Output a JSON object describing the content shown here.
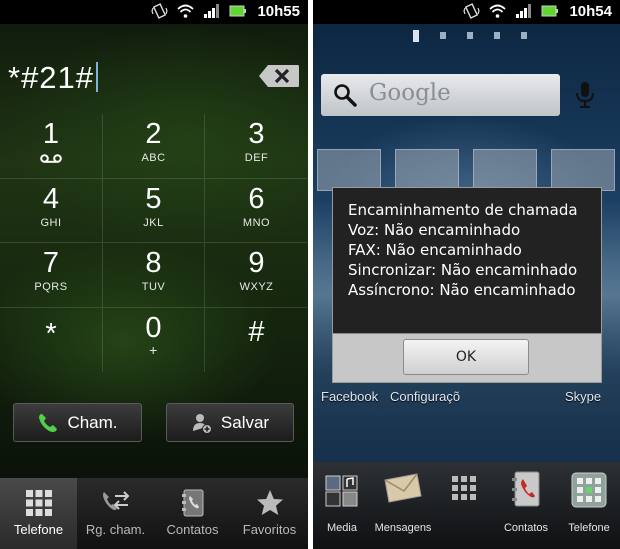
{
  "left_screen": {
    "status": {
      "time": "10h55",
      "icons": [
        "vibrate-icon",
        "wifi-icon",
        "signal-icon",
        "battery-icon"
      ]
    },
    "dial_number": "*#21#",
    "keypad": [
      {
        "digit": "1",
        "letters": ""
      },
      {
        "digit": "2",
        "letters": "ABC"
      },
      {
        "digit": "3",
        "letters": "DEF"
      },
      {
        "digit": "4",
        "letters": "GHI"
      },
      {
        "digit": "5",
        "letters": "JKL"
      },
      {
        "digit": "6",
        "letters": "MNO"
      },
      {
        "digit": "7",
        "letters": "PQRS"
      },
      {
        "digit": "8",
        "letters": "TUV"
      },
      {
        "digit": "9",
        "letters": "WXYZ"
      },
      {
        "digit": "*",
        "letters": ""
      },
      {
        "digit": "0",
        "letters": "+"
      },
      {
        "digit": "#",
        "letters": ""
      }
    ],
    "call_button": "Cham.",
    "save_button": "Salvar",
    "tabs": [
      "Telefone",
      "Rg. cham.",
      "Contatos",
      "Favoritos"
    ],
    "active_tab": "Telefone"
  },
  "right_screen": {
    "status": {
      "time": "10h54",
      "icons": [
        "vibrate-icon",
        "wifi-icon",
        "signal-icon",
        "battery-icon"
      ]
    },
    "search_label": "Google",
    "app_labels": [
      "Facebook",
      "Configuraçõ",
      "Skype"
    ],
    "dialog": {
      "lines": [
        "Encaminhamento de chamada",
        "Voz: Não encaminhado",
        "FAX: Não encaminhado",
        "Sincronizar: Não encaminhado",
        "Assíncrono: Não encaminhado"
      ],
      "ok_label": "OK"
    },
    "dock": [
      "Media",
      "Mensagens",
      "",
      "Contatos",
      "Telefone"
    ]
  },
  "colors": {
    "accent_green": "#4fd14b",
    "dialog_bg": "#222222",
    "dialog_footer": "#c7c7c7"
  }
}
